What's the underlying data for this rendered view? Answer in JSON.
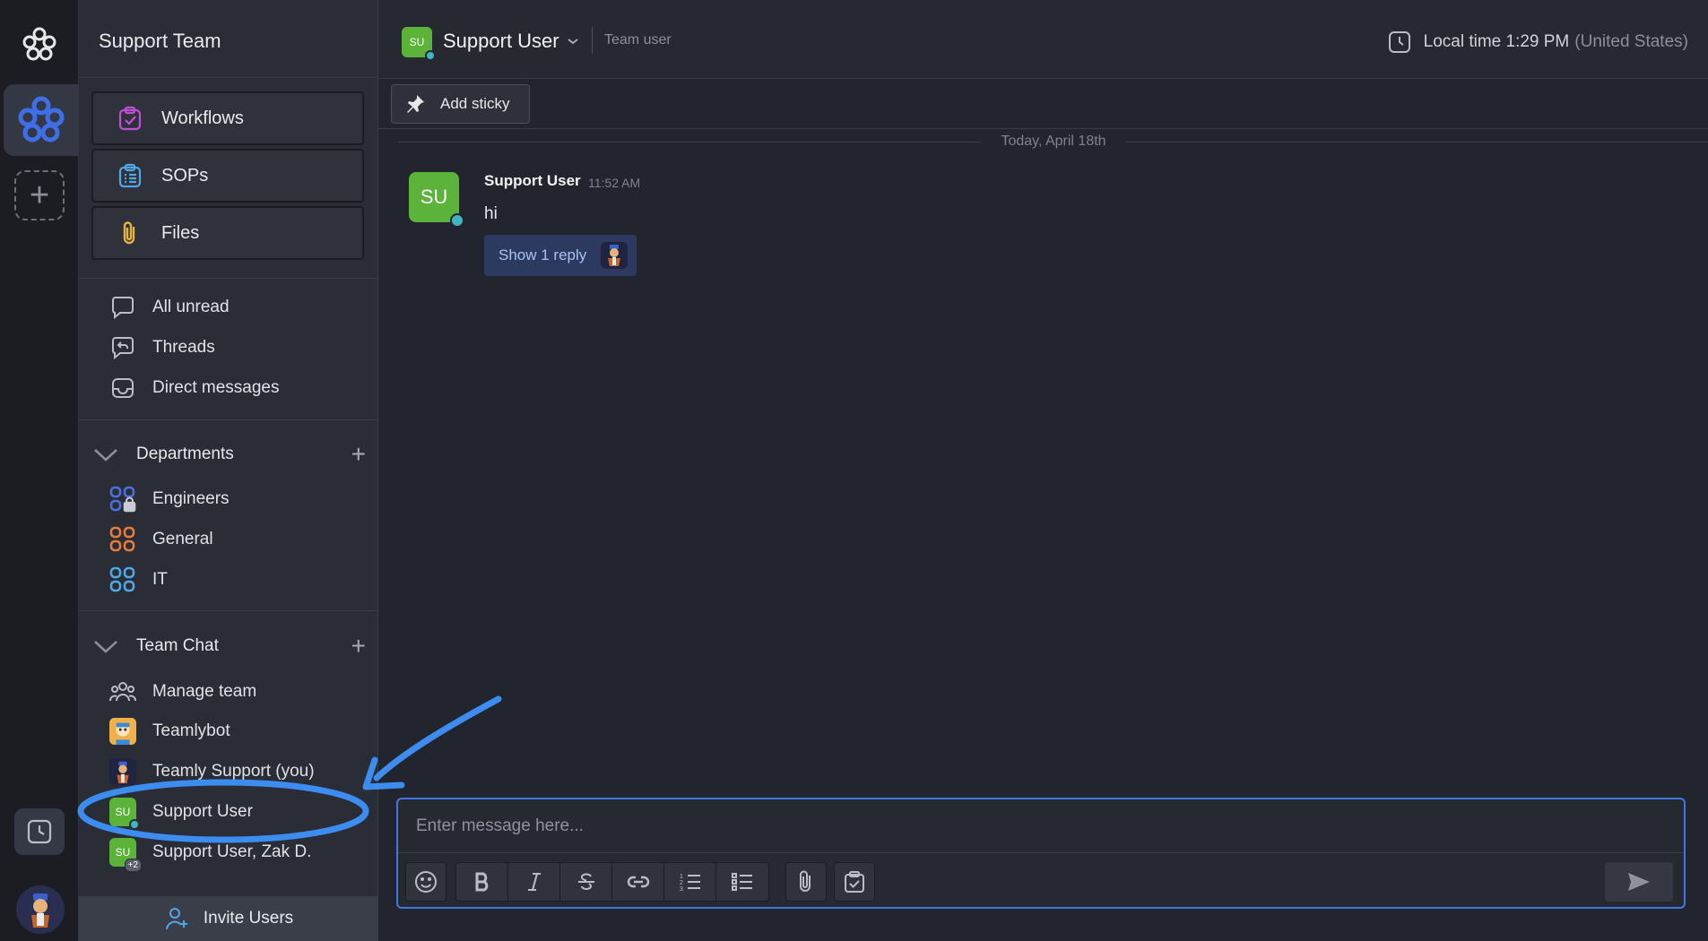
{
  "workspace": {
    "name": "Support Team"
  },
  "tools": [
    {
      "label": "Workflows",
      "icon": "workflow-icon"
    },
    {
      "label": "SOPs",
      "icon": "sop-icon"
    },
    {
      "label": "Files",
      "icon": "paperclip-icon"
    }
  ],
  "nav": {
    "all_unread": "All unread",
    "threads": "Threads",
    "direct_messages": "Direct messages"
  },
  "departments": {
    "title": "Departments",
    "items": [
      "Engineers",
      "General",
      "IT"
    ]
  },
  "team_chat": {
    "title": "Team Chat",
    "manage": "Manage team",
    "members": [
      {
        "label": "Teamlybot"
      },
      {
        "label": "Teamly Support (you)"
      },
      {
        "label": "Support User",
        "initials": "SU"
      },
      {
        "label": "Support User, Zak D.",
        "initials": "SU",
        "badge": "+2"
      }
    ]
  },
  "invite_label": "Invite Users",
  "header": {
    "initials": "SU",
    "name": "Support User",
    "role": "Team user",
    "local_time": "Local time 1:29 PM",
    "region": "(United States)"
  },
  "sticky_label": "Add sticky",
  "date_separator": "Today, April 18th",
  "message": {
    "initials": "SU",
    "author": "Support User",
    "time": "11:52 AM",
    "text": "hi",
    "reply_label": "Show 1 reply"
  },
  "composer": {
    "placeholder": "Enter message here..."
  },
  "colors": {
    "accent": "#3f77e6",
    "user_green": "#5bb33a",
    "online": "#3fb6c4",
    "annotation": "#3d8cf0"
  }
}
